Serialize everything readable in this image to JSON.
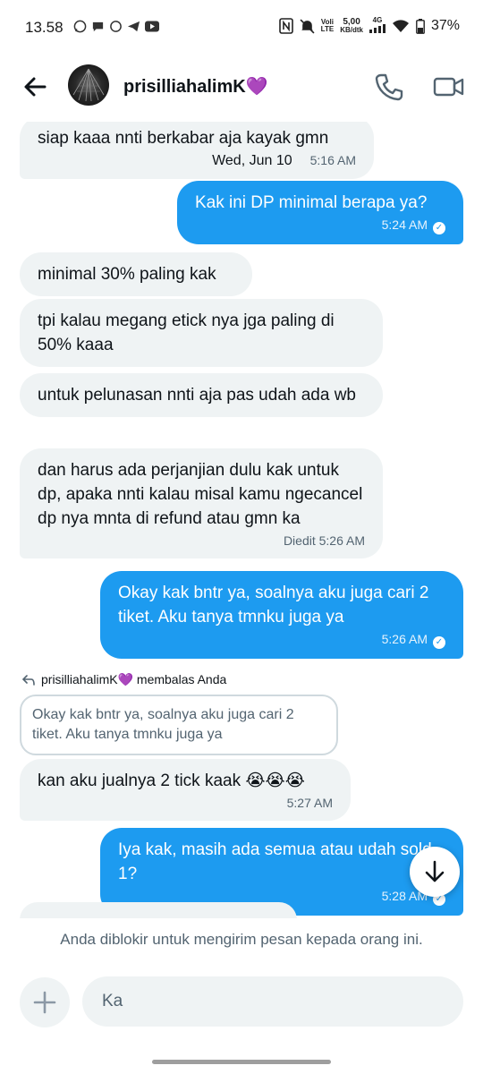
{
  "status_bar": {
    "time": "13.58",
    "net_1": "Voli",
    "net_2": "LTE",
    "speed_value": "5,00",
    "speed_unit": "KB/dtk",
    "signal": "4G",
    "battery": "37%"
  },
  "header": {
    "name": "prisilliahalimK💜"
  },
  "messages": [
    {
      "text": "siap kaaa nnti berkabar aja kayak gmn",
      "date": "Wed, Jun 10",
      "time": "5:16 AM"
    },
    {
      "text": "Kak ini DP minimal berapa ya?",
      "time": "5:24 AM"
    },
    {
      "text": "minimal 30% paling kak"
    },
    {
      "text": "tpi kalau megang etick nya jga paling di 50% kaaa"
    },
    {
      "text": "untuk pelunasan nnti aja pas udah ada wb"
    },
    {
      "text": "dan harus ada perjanjian dulu kak untuk dp, apaka nnti kalau misal kamu ngecancel dp nya mnta di refund atau gmn ka",
      "time": "Diedit 5:26 AM"
    },
    {
      "text": "Okay kak bntr ya, soalnya aku juga cari 2 tiket. Aku tanya tmnku juga ya",
      "time": "5:26 AM"
    },
    {
      "text": "kan aku jualnya 2 tick kaak 😭😭😭",
      "time": "5:27 AM"
    },
    {
      "text": "Iya kak, masih ada semua atau udah sold 1?",
      "time": "5:28 AM"
    }
  ],
  "reply": {
    "label": "prisilliahalimK💜 membalas Anda",
    "quote": "Okay kak bntr ya, soalnya aku juga cari 2 tiket. Aku tanya tmnku juga ya"
  },
  "footer": {
    "blocked_notice": "Anda diblokir untuk mengirim pesan kepada orang ini.",
    "input_placeholder": "Ka"
  }
}
